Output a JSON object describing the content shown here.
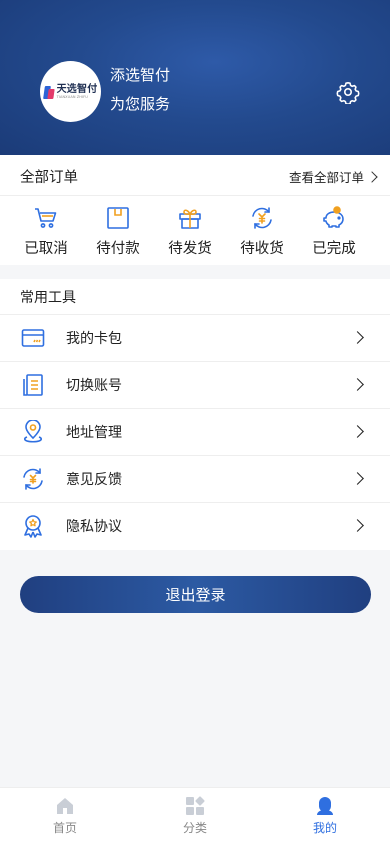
{
  "profile": {
    "logo_text": "天选智付",
    "logo_subtext": "TIANXUAN ZHIFU",
    "name": "添选智付",
    "slogan": "为您服务",
    "settings_icon": "gear-icon"
  },
  "orders": {
    "title": "全部订单",
    "view_all": "查看全部订单",
    "items": [
      {
        "label": "已取消",
        "icon": "cart-icon"
      },
      {
        "label": "待付款",
        "icon": "wallet-icon"
      },
      {
        "label": "待发货",
        "icon": "gift-icon"
      },
      {
        "label": "待收货",
        "icon": "yuan-cycle-icon"
      },
      {
        "label": "已完成",
        "icon": "piggy-bank-icon"
      }
    ]
  },
  "tools": {
    "title": "常用工具",
    "items": [
      {
        "label": "我的卡包",
        "icon": "card-icon"
      },
      {
        "label": "切换账号",
        "icon": "document-icon"
      },
      {
        "label": "地址管理",
        "icon": "location-pin-icon"
      },
      {
        "label": "意见反馈",
        "icon": "feedback-icon"
      },
      {
        "label": "隐私协议",
        "icon": "award-icon"
      }
    ]
  },
  "logout_label": "退出登录",
  "tabbar": {
    "items": [
      {
        "label": "首页",
        "icon": "home-icon",
        "active": false
      },
      {
        "label": "分类",
        "icon": "category-icon",
        "active": false
      },
      {
        "label": "我的",
        "icon": "user-icon",
        "active": true
      }
    ]
  },
  "colors": {
    "header_dark": "#1b3b78",
    "header_light": "#2e5aa8",
    "icon_blue": "#2f6fe0",
    "icon_orange": "#f0a020",
    "tab_active": "#2f6fe0"
  }
}
